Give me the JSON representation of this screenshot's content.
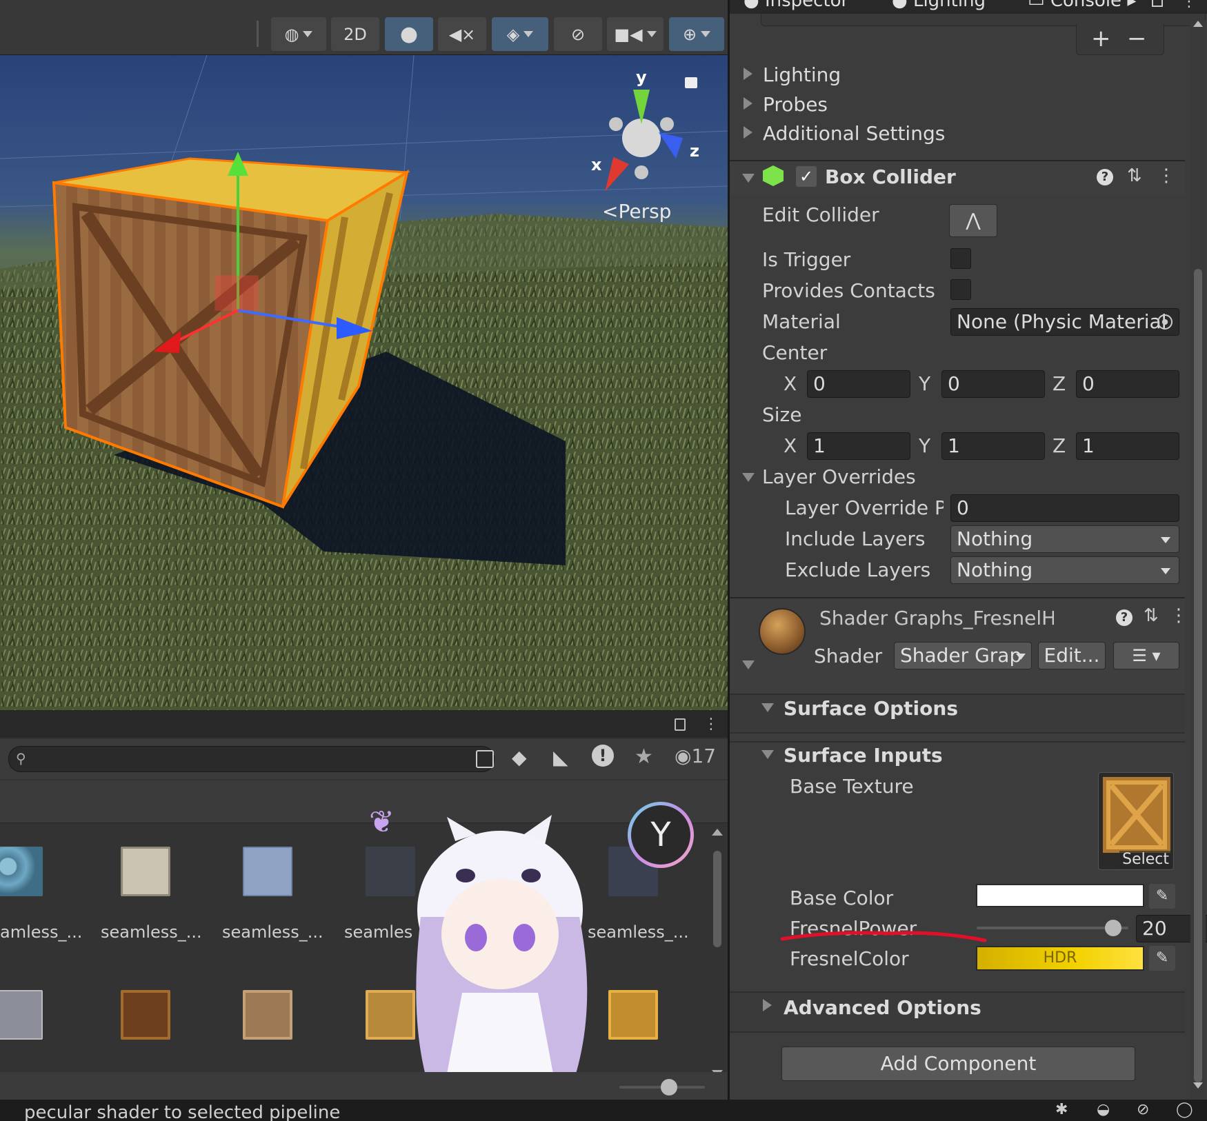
{
  "tabs": {
    "inspector": "Inspector",
    "lighting": "Lighting",
    "shader_graph": "Shader Graphs_Fresne",
    "console": "Console"
  },
  "scene": {
    "toolbar": {
      "btn_2d": "2D"
    },
    "gizmo": {
      "y": "y",
      "x": "x",
      "z": "z",
      "persp": "Persp"
    }
  },
  "inspector": {
    "collapsed_sections": [
      "Lighting",
      "Probes",
      "Additional Settings"
    ],
    "box_collider": {
      "title": "Box Collider",
      "edit_collider": "Edit Collider",
      "is_trigger": "Is Trigger",
      "provides_contacts": "Provides Contacts",
      "material_label": "Material",
      "material_value": "None (Physic Material",
      "center_label": "Center",
      "center": {
        "x": "0",
        "y": "0",
        "z": "0"
      },
      "size_label": "Size",
      "size": {
        "x": "1",
        "y": "1",
        "z": "1"
      },
      "axis": {
        "x": "X",
        "y": "Y",
        "z": "Z"
      },
      "layer_overrides": "Layer Overrides",
      "layer_override_priority_label": "Layer Override Priı",
      "layer_override_priority": "0",
      "include_layers_label": "Include Layers",
      "include_layers": "Nothing",
      "exclude_layers_label": "Exclude Layers",
      "exclude_layers": "Nothing"
    },
    "material": {
      "title": "Shader Graphs_FresnelHighlig",
      "shader_label": "Shader",
      "shader_value": "Shader Grap",
      "edit_button": "Edit...",
      "surface_options": "Surface Options",
      "surface_inputs": "Surface Inputs",
      "base_texture": "Base Texture",
      "select": "Select",
      "base_color": "Base Color",
      "fresnel_power_label": "FresnelPower",
      "fresnel_power": "20",
      "fresnel_power_fraction": 0.9,
      "fresnel_color": "FresnelColor",
      "hdr": "HDR",
      "advanced_options": "Advanced Options"
    },
    "add_component": "Add Component"
  },
  "project": {
    "visible_count": "17",
    "assets_row1": [
      "amless_...",
      "seamless_...",
      "seamless_...",
      "seamles",
      "seamless_..."
    ]
  },
  "status_bar": {
    "message": "pecular shader to selected pipeline"
  },
  "colors": {
    "selection_outline": "#ff7a00",
    "hdr_yellow": "#f2d200",
    "annotation_red": "#e0102a",
    "accent_blue": "#46607c"
  }
}
